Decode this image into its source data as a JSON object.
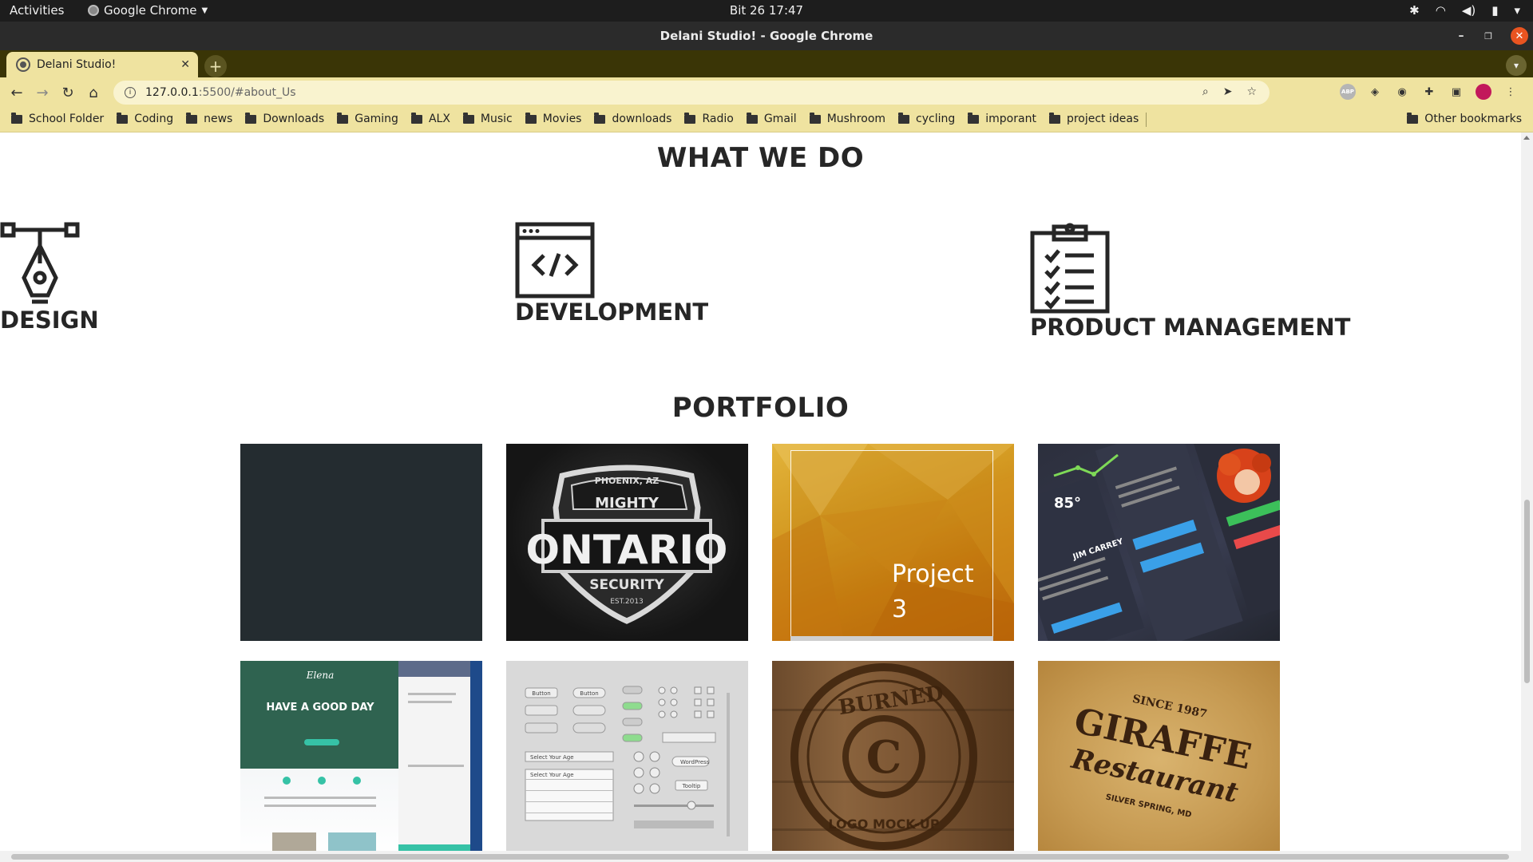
{
  "os_bar": {
    "activities": "Activities",
    "app_name": "Google Chrome",
    "clock": "Bit 26  17:47"
  },
  "window": {
    "title": "Delani Studio! - Google Chrome"
  },
  "tabs": [
    {
      "title": "Delani Studio!"
    }
  ],
  "address_bar": {
    "host": "127.0.0.1",
    "path": ":5500/#about_Us"
  },
  "bookmarks": [
    "School Folder",
    "Coding",
    "news",
    "Downloads",
    "Gaming",
    "ALX",
    "Music",
    "Movies",
    "downloads",
    "Radio",
    "Gmail",
    "Mushroom",
    "cycling",
    "imporant",
    "project ideas"
  ],
  "other_bookmarks": "Other bookmarks",
  "page": {
    "what_we_do": {
      "heading": "WHAT WE DO",
      "services": [
        {
          "label": "DESIGN",
          "icon": "pen-tool-icon"
        },
        {
          "label": "DEVELOPMENT",
          "icon": "code-window-icon"
        },
        {
          "label": "PRODUCT MANAGEMENT",
          "icon": "clipboard-checklist-icon"
        }
      ]
    },
    "portfolio": {
      "heading": "PORTFOLIO",
      "hover_project_label": "Project 3",
      "logo_texts": {
        "ontario_top": "PHOENIX, AZ",
        "ontario_mighty": "MIGHTY",
        "ontario_main": "ONTARIO",
        "ontario_security": "SECURITY",
        "ontario_est": "EST.2013",
        "app_weather": "85°",
        "app_name": "JIM CARREY",
        "landing_brand": "Elena",
        "landing_headline": "HAVE A GOOD DAY",
        "ui_button": "Button",
        "ui_select": "Select Your Age",
        "ui_wordpress": "WordPress",
        "ui_tooltip": "Tooltip",
        "burned_word": "BURNED",
        "burned_sub": "LOGO MOCK-UP",
        "giraffe_since": "SINCE 1987",
        "giraffe_main": "GIRAFFE",
        "giraffe_restaurant": "Restaurant",
        "giraffe_place": "SILVER SPRING, MD"
      }
    }
  },
  "colors": {
    "chrome_theme": "#efe3a0",
    "tab_strip": "#3a3506",
    "heading_text": "#262626",
    "close_button": "#e95420"
  }
}
